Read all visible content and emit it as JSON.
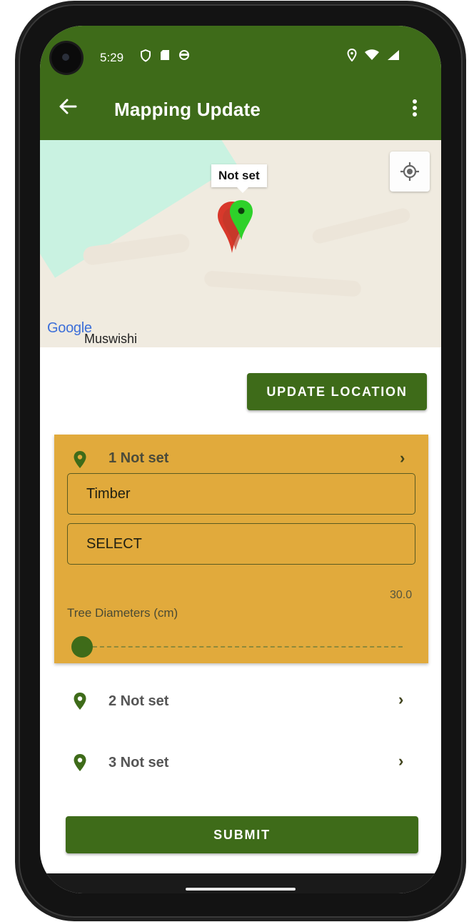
{
  "status_bar": {
    "time": "5:29",
    "left_icons": [
      "shield-icon",
      "sd-card-icon",
      "sync-icon"
    ],
    "right_icons": [
      "location-icon",
      "wifi-icon",
      "signal-icon"
    ]
  },
  "app_bar": {
    "title": "Mapping Update",
    "back_icon": "arrow-left-icon",
    "menu_icon": "more-vert-icon",
    "color": "#3e6b19"
  },
  "map": {
    "marker_label": "Not set",
    "logo_text": "Google",
    "place_label": "Muswishi",
    "locate_icon": "my-location-icon"
  },
  "actions": {
    "update_location": "UPDATE LOCATION",
    "submit": "SUBMIT"
  },
  "entries": [
    {
      "title": "1 Not set",
      "expanded": true,
      "type_value": "Timber",
      "select_value": "SELECT",
      "slider_label": "Tree Diameters (cm)",
      "slider_max": "30.0",
      "slider_value": 0
    },
    {
      "title": "2 Not set",
      "expanded": false
    },
    {
      "title": "3 Not set",
      "expanded": false
    }
  ],
  "colors": {
    "primary": "#3e6b19",
    "expanded_card": "#e1aa3c"
  }
}
